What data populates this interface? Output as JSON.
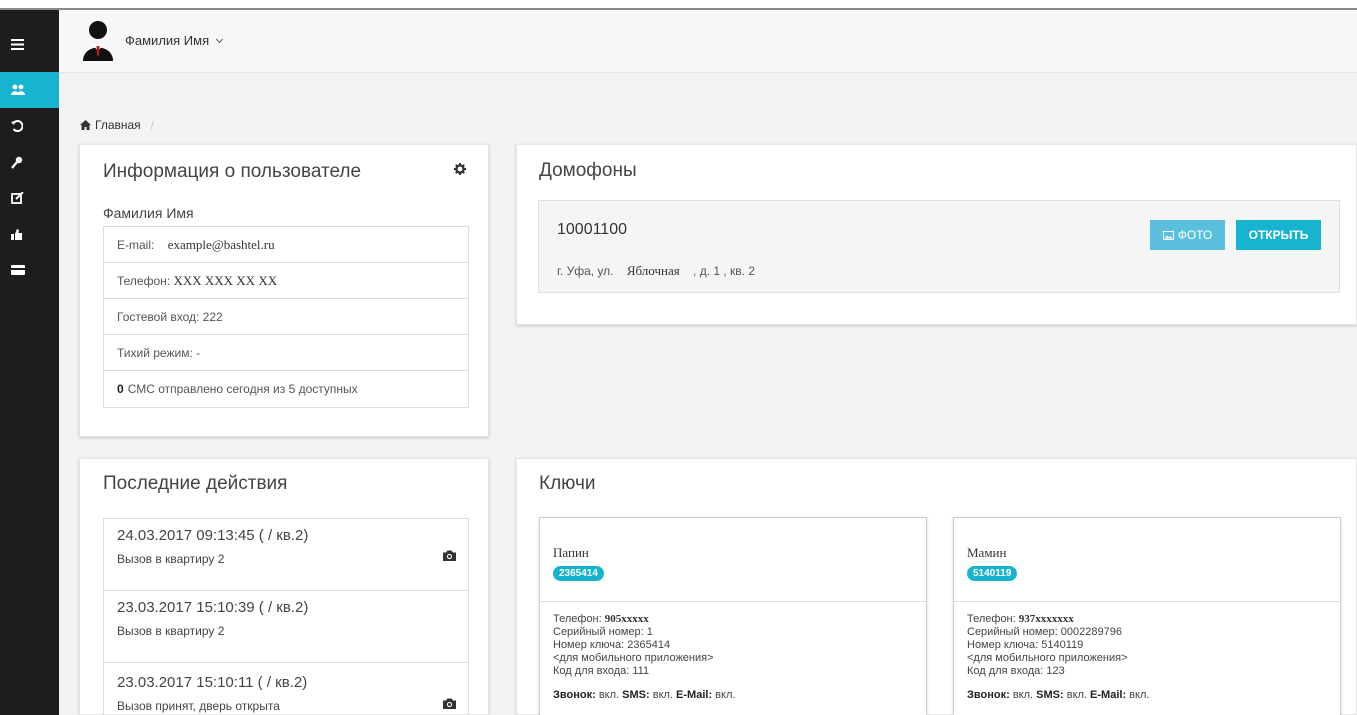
{
  "header": {
    "user_name": "Фамилия Имя"
  },
  "breadcrumb": {
    "home": "Главная",
    "separator": "/"
  },
  "user_info": {
    "title": "Информация о пользователе",
    "name": "Фамилия Имя",
    "email_label": "E-mail:",
    "email_value": "example@bashtel.ru",
    "phone_label": "Телефон:",
    "phone_value": "XXX XXX XX XX",
    "guest_entry": "Гостевой вход: 222",
    "silent_mode": "Тихий режим: -",
    "sms_count": "0",
    "sms_text": "СМС отправлено сегодня из 5 доступных"
  },
  "intercoms": {
    "title": "Домофоны",
    "number": "10001100",
    "addr_prefix": "г. Уфа, ул.",
    "street": "Яблочная",
    "addr_suffix": ", д. 1 , кв. 2",
    "photo_button": "ФОТО",
    "open_button": "ОТКРЫТЬ"
  },
  "recent": {
    "title": "Последние действия",
    "items": [
      {
        "time": "24.03.2017 09:13:45 ( / кв.2)",
        "desc": "Вызов в квартиру 2",
        "camera": true
      },
      {
        "time": "23.03.2017 15:10:39 ( / кв.2)",
        "desc": "Вызов в квартиру 2",
        "camera": false
      },
      {
        "time": "23.03.2017 15:10:11 ( / кв.2)",
        "desc": "Вызов принят, дверь открыта",
        "camera": true
      }
    ]
  },
  "keys": {
    "title": "Ключи",
    "labels": {
      "phone": "Телефон:",
      "serial": "Серийный номер:",
      "key_number": "Номер ключа:",
      "mobile": "<для мобильного приложения>",
      "code": "Код для входа:",
      "call": "Звонок:",
      "sms": "SMS:",
      "email": "E-Mail:",
      "on": "вкл."
    },
    "items": [
      {
        "name": "Папин",
        "badge": "2365414",
        "phone": "905xxxxx",
        "serial": "1",
        "key_number": "2365414",
        "code": "111"
      },
      {
        "name": "Мамин",
        "badge": "5140119",
        "phone": "937xxxxxxx",
        "serial": "0002289796",
        "key_number": "5140119",
        "code": "123"
      }
    ]
  },
  "colors": {
    "accent": "#17b4cf",
    "photo_button": "#5bc0de",
    "sidebar": "#1d1d1d"
  },
  "icons": {
    "sidebar": [
      "menu-icon",
      "users-icon",
      "history-icon",
      "key-icon",
      "edit-icon",
      "thumbs-up-icon",
      "card-icon"
    ],
    "misc": [
      "home-icon",
      "gear-icon",
      "image-icon",
      "camera-icon",
      "avatar-icon"
    ]
  }
}
